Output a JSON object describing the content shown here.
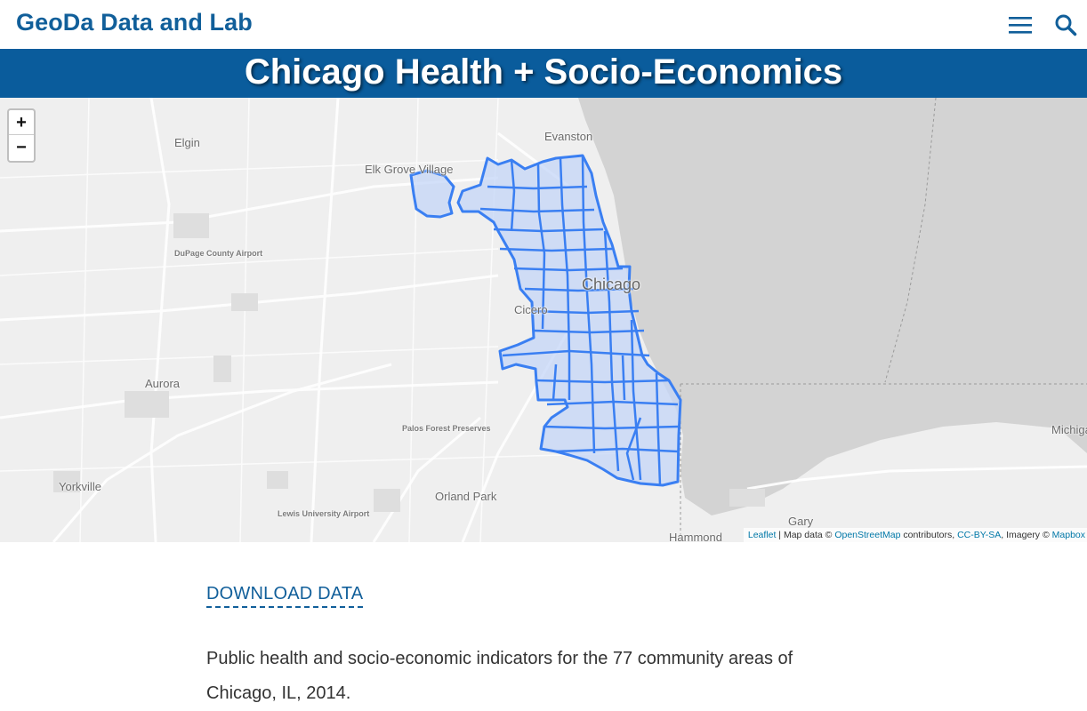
{
  "header": {
    "site_title": "GeoDa Data and Lab",
    "menu_icon": "hamburger-menu-icon",
    "search_icon": "search-icon"
  },
  "banner": {
    "title": "Chicago Health + Socio-Economics"
  },
  "map": {
    "zoom_in_label": "+",
    "zoom_out_label": "−",
    "places": {
      "elgin": "Elgin",
      "evanston": "Evanston",
      "elk_grove": "Elk Grove Village",
      "dupage": "DuPage County Airport",
      "chicago": "Chicago",
      "cicero": "Cicero",
      "aurora": "Aurora",
      "palos": "Palos Forest Preserves",
      "yorkville": "Yorkville",
      "orland": "Orland Park",
      "lewis": "Lewis University Airport",
      "gary": "Gary",
      "hammond": "Hammond",
      "michigan": "Michiga"
    },
    "attribution": {
      "leaflet": "Leaflet",
      "map_data": " | Map data © ",
      "osm": "OpenStreetMap",
      "contributors": " contributors, ",
      "license": "CC-BY-SA",
      "imagery": ", Imagery © ",
      "mapbox": "Mapbox"
    },
    "colors": {
      "water": "#d3d3d3",
      "land": "#efefef",
      "boundary": "#3a7ff2",
      "fill": "#c4d6f7"
    }
  },
  "content": {
    "download_label": "DOWNLOAD DATA",
    "description": "Public health and socio-economic indicators for the 77 community areas of Chicago, IL, 2014."
  }
}
